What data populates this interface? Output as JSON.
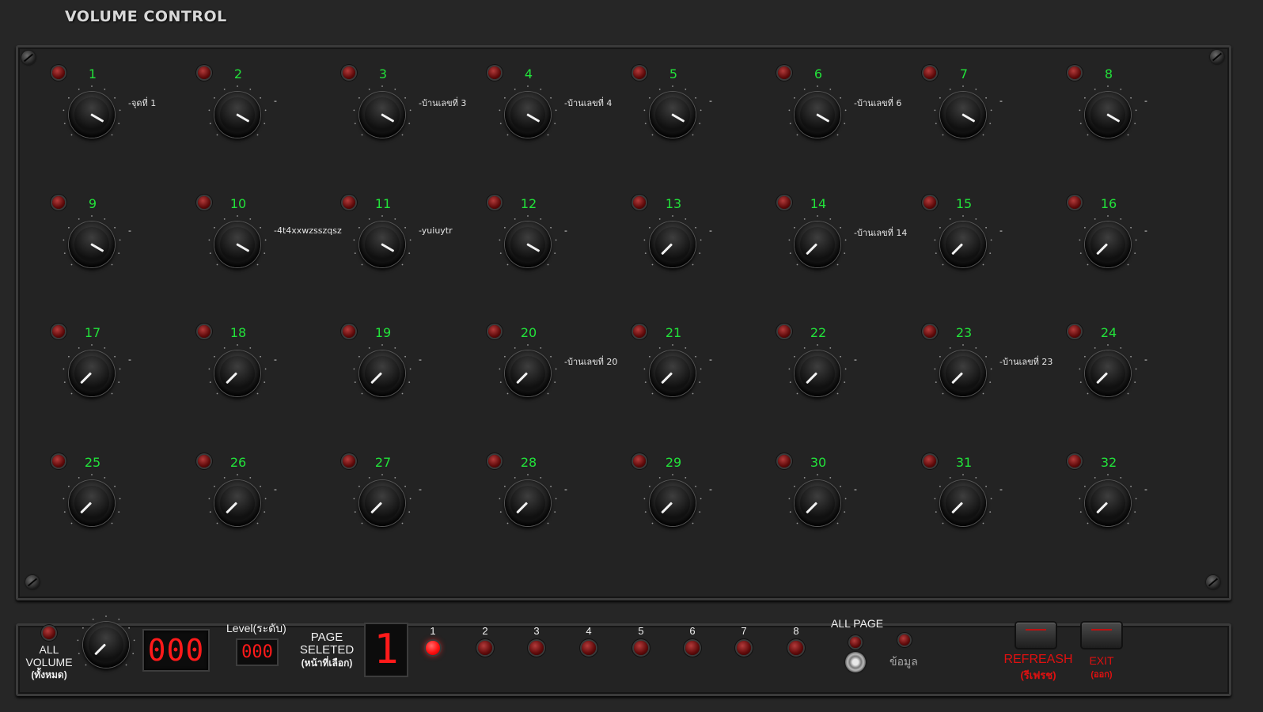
{
  "app": {
    "title": "VOLUME CONTROL"
  },
  "channels": [
    {
      "num": "1",
      "label": "-จุดที่ 1",
      "level": 0.78
    },
    {
      "num": "2",
      "label": "-",
      "level": 0.78
    },
    {
      "num": "3",
      "label": "-บ้านเลขที่ 3",
      "level": 0.78
    },
    {
      "num": "4",
      "label": "-บ้านเลขที่ 4",
      "level": 0.78
    },
    {
      "num": "5",
      "label": "-",
      "level": 0.78
    },
    {
      "num": "6",
      "label": "-บ้านเลขที่ 6",
      "level": 0.78
    },
    {
      "num": "7",
      "label": "-",
      "level": 0.78
    },
    {
      "num": "8",
      "label": "-",
      "level": 0.78
    },
    {
      "num": "9",
      "label": "-",
      "level": 0.78
    },
    {
      "num": "10",
      "label": "-4t4xxwzsszqsz",
      "level": 0.78
    },
    {
      "num": "11",
      "label": "-yuiuytr",
      "level": 0.78
    },
    {
      "num": "12",
      "label": "-",
      "level": 0.78
    },
    {
      "num": "13",
      "label": "-",
      "level": 0.0
    },
    {
      "num": "14",
      "label": "-บ้านเลขที่ 14",
      "level": 0.0
    },
    {
      "num": "15",
      "label": "-",
      "level": 0.0
    },
    {
      "num": "16",
      "label": "-",
      "level": 0.0
    },
    {
      "num": "17",
      "label": "-",
      "level": 0.0
    },
    {
      "num": "18",
      "label": "-",
      "level": 0.0
    },
    {
      "num": "19",
      "label": "-",
      "level": 0.0
    },
    {
      "num": "20",
      "label": "-บ้านเลขที่ 20",
      "level": 0.0
    },
    {
      "num": "21",
      "label": "-",
      "level": 0.0
    },
    {
      "num": "22",
      "label": "-",
      "level": 0.0
    },
    {
      "num": "23",
      "label": "-บ้านเลขที่ 23",
      "level": 0.0
    },
    {
      "num": "24",
      "label": "-",
      "level": 0.0
    },
    {
      "num": "25",
      "label": "",
      "level": 0.0
    },
    {
      "num": "26",
      "label": "-",
      "level": 0.0
    },
    {
      "num": "27",
      "label": "-",
      "level": 0.0
    },
    {
      "num": "28",
      "label": "-",
      "level": 0.0
    },
    {
      "num": "29",
      "label": "-",
      "level": 0.0
    },
    {
      "num": "30",
      "label": "-",
      "level": 0.0
    },
    {
      "num": "31",
      "label": "-",
      "level": 0.0
    },
    {
      "num": "32",
      "label": "-",
      "level": 0.0
    }
  ],
  "bottom": {
    "all_volume": {
      "line1": "ALL",
      "line2": "VOLUME",
      "line3": "(ทั้งหมด)",
      "display": "000",
      "level": 0.0
    },
    "level": {
      "label": "Level(ระดับ)",
      "display": "000"
    },
    "page": {
      "line1": "PAGE",
      "line2": "SELETED",
      "line3": "(หน้าที่เลือก)",
      "display": "1"
    },
    "pages": [
      {
        "num": "1",
        "active": true
      },
      {
        "num": "2",
        "active": false
      },
      {
        "num": "3",
        "active": false
      },
      {
        "num": "4",
        "active": false
      },
      {
        "num": "5",
        "active": false
      },
      {
        "num": "6",
        "active": false
      },
      {
        "num": "7",
        "active": false
      },
      {
        "num": "8",
        "active": false
      }
    ],
    "all_page_label": "ALL PAGE",
    "info_label": "ข้อมูล",
    "refresh": {
      "label": "REFREASH",
      "sub": "(รีเฟรช)"
    },
    "exit": {
      "label": "EXIT",
      "sub": "(ออก)"
    }
  },
  "colors": {
    "channel_number": "#22e23a",
    "display_red": "#ff1a1a",
    "button_red": "#e01010",
    "panel": "#232323"
  }
}
